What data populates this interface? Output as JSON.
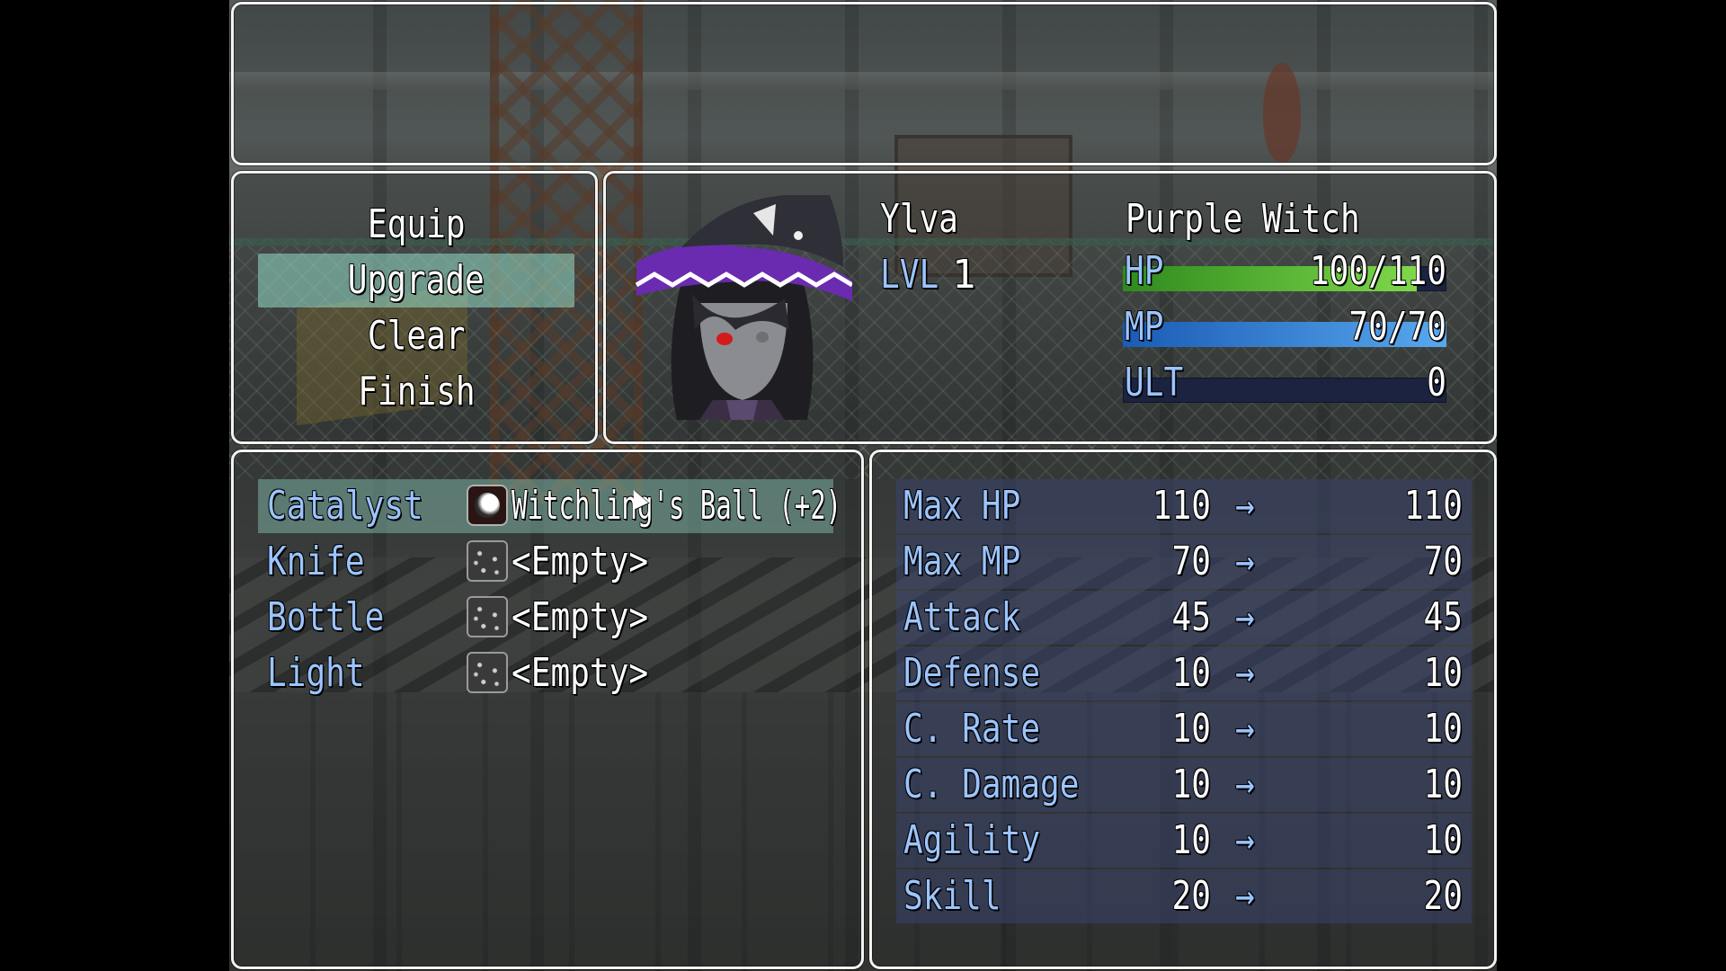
{
  "menu": {
    "items": [
      "Equip",
      "Upgrade",
      "Clear",
      "Finish"
    ],
    "selected_index": 1
  },
  "actor": {
    "name": "Ylva",
    "class": "Purple Witch",
    "level_label": "LVL",
    "level": "1",
    "hp_label": "HP",
    "hp_text": "100/110",
    "hp_fraction": 0.909,
    "mp_label": "MP",
    "mp_text": "70/70",
    "mp_fraction": 1.0,
    "ult_label": "ULT",
    "ult_text": "0",
    "ult_fraction": 0,
    "hp_color_start": "#2e8a1e",
    "hp_color_end": "#7fd84a",
    "mp_color_start": "#1a5bb5",
    "mp_color_end": "#58a8ee"
  },
  "slots": [
    {
      "name": "Catalyst",
      "item": "Witchling's Ball (+2)",
      "icon": "orb-icon"
    },
    {
      "name": "Knife",
      "item": "<Empty>",
      "icon": "empty-slot-icon"
    },
    {
      "name": "Bottle",
      "item": "<Empty>",
      "icon": "empty-slot-icon"
    },
    {
      "name": "Light",
      "item": "<Empty>",
      "icon": "empty-slot-icon"
    }
  ],
  "stats": [
    {
      "name": "Max HP",
      "current": "110",
      "next": "110"
    },
    {
      "name": "Max MP",
      "current": "70",
      "next": "70"
    },
    {
      "name": "Attack",
      "current": "45",
      "next": "45"
    },
    {
      "name": "Defense",
      "current": "10",
      "next": "10"
    },
    {
      "name": "C. Rate",
      "current": "10",
      "next": "10"
    },
    {
      "name": "C. Damage",
      "current": "10",
      "next": "10"
    },
    {
      "name": "Agility",
      "current": "10",
      "next": "10"
    },
    {
      "name": "Skill",
      "current": "20",
      "next": "20"
    }
  ],
  "arrow_glyph": "→"
}
